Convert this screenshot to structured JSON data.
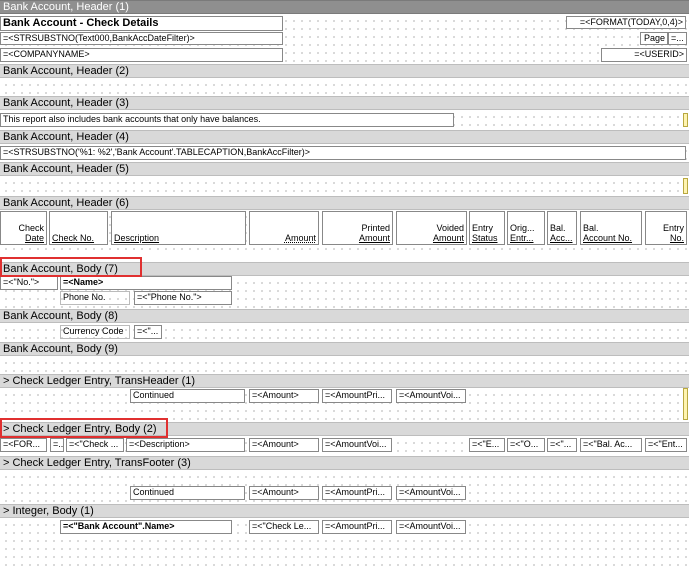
{
  "bands": {
    "b0": "Bank Account, Header (1)",
    "b1": "Bank Account, Header (2)",
    "b2": "Bank Account, Header (3)",
    "b3": "Bank Account, Header (4)",
    "b4": "Bank Account, Header (5)",
    "b5": "Bank Account, Header (6)",
    "b6": "Bank Account, Body (7)",
    "b7": "Bank Account, Body (8)",
    "b8": "Bank Account, Body (9)",
    "b9": "> Check Ledger Entry, TransHeader (1)",
    "b10": "> Check Ledger Entry, Body (2)",
    "b11": "> Check Ledger Entry, TransFooter (3)",
    "b12": "> Integer, Body (1)"
  },
  "header1": {
    "title": "Bank Account - Check Details",
    "date_filter": "=<STRSUBSTNO(Text000,BankAccDateFilter)>",
    "company": "=<COMPANYNAME>",
    "today": "=<FORMAT(TODAY,0,4)>",
    "page_label": "Page",
    "page_value": "=...",
    "userid": "=<USERID>"
  },
  "header3": {
    "note": "This report also includes bank accounts that only have balances."
  },
  "header4": {
    "filter": "=<STRSUBSTNO('%1: %2','Bank Account'.TABLECAPTION,BankAccFilter)>"
  },
  "header6": {
    "check_date_1": "Check",
    "check_date_2": "Date",
    "check_no": "Check No.",
    "description": "Description",
    "amount": "Amount",
    "printed_1": "Printed",
    "printed_2": "Amount",
    "voided_1": "Voided",
    "voided_2": "Amount",
    "entry_status_1": "Entry",
    "entry_status_2": "Status",
    "orig_1": "Orig...",
    "orig_2": "Entr...",
    "bal_acc_1": "Bal.",
    "bal_acc_2": "Acc...",
    "bal_no_1": "Bal.",
    "bal_no_2": "Account No.",
    "entry_no_1": "Entry",
    "entry_no_2": "No."
  },
  "body7": {
    "no": "=<\"No.\">",
    "name": "=<Name>",
    "phone_label": "Phone No.",
    "phone_value": "=<\"Phone No.\">"
  },
  "body8": {
    "currency_label": "Currency Code",
    "currency_value": "=<\"..."
  },
  "transheader": {
    "continued": "Continued",
    "amount": "=<Amount>",
    "amount_printed": "=<AmountPri...",
    "amount_voided": "=<AmountVoi..."
  },
  "ledgerbody": {
    "c1": "=<FOR...",
    "c2": "=...",
    "c3": "=<\"Check ...",
    "c4": "=<Description>",
    "c5": "=<Amount>",
    "c6": "=<AmountVoi...",
    "c7": "=<\"E...",
    "c8": "=<\"O...",
    "c9": "=<\"...",
    "c10": "=<\"Bal. Ac...",
    "c11": "=<\"Ent..."
  },
  "transfooter": {
    "continued": "Continued",
    "amount": "=<Amount>",
    "amount_printed": "=<AmountPri...",
    "amount_voided": "=<AmountVoi..."
  },
  "integer": {
    "name": "=<\"Bank Account\".Name>",
    "check_ledger": "=<\"Check Le...",
    "amount_printed": "=<AmountPri...",
    "amount_voided": "=<AmountVoi..."
  }
}
